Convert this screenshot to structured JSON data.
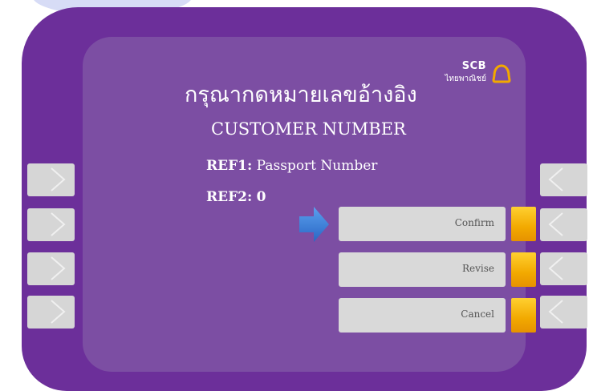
{
  "brand": {
    "name_en": "SCB",
    "name_th": "ไทยพาณิชย์",
    "logo_color": "#f2a900"
  },
  "screen": {
    "title_th": "กรุณากดหมายเลขอ้างอิง",
    "subtitle": "CUSTOMER NUMBER",
    "ref1_label": "REF1:",
    "ref1_value": "Passport Number",
    "ref2_label": "REF2:",
    "ref2_value": "0"
  },
  "options": [
    {
      "label": "Confirm",
      "selected": true
    },
    {
      "label": "Revise"
    },
    {
      "label": "Cancel"
    }
  ],
  "pointer": {
    "icon": "arrow-right-icon",
    "color": "#3b7fd6"
  },
  "colors": {
    "frame": "#6c2f9a",
    "screen": "#7c4ea3",
    "option_button": "#d9d9d9",
    "indicator": "#f2a900",
    "side_key": "#d6d6d6"
  }
}
